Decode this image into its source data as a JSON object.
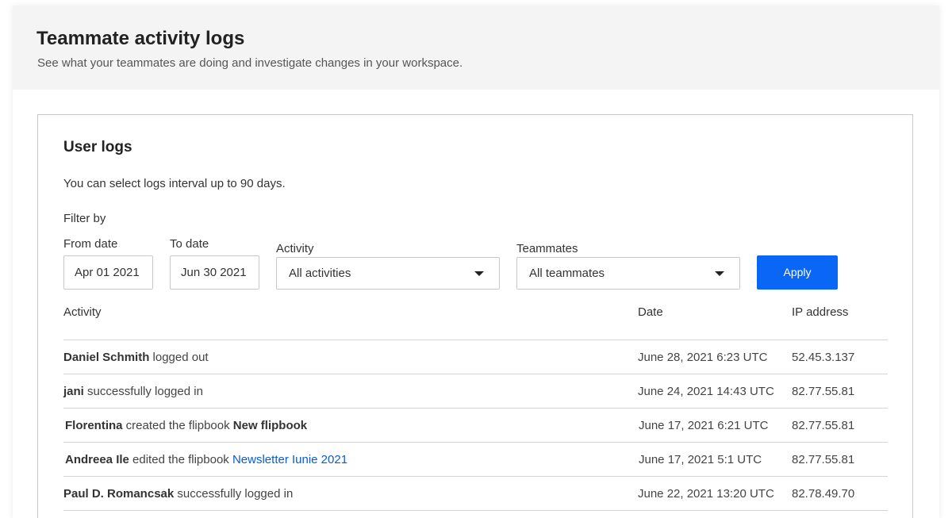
{
  "header": {
    "title": "Teammate activity logs",
    "subtitle": "See what your teammates are doing and investigate changes in your workspace."
  },
  "card": {
    "title": "User logs",
    "note": "You can select logs interval up to 90 days.",
    "filter_label": "Filter by"
  },
  "filters": {
    "from_label": "From date",
    "from_value": "Apr 01 2021",
    "to_label": "To date",
    "to_value": "Jun 30 2021",
    "activity_label": "Activity",
    "activity_value": "All activities",
    "teammates_label": "Teammates",
    "teammates_value": "All teammates",
    "apply_label": "Apply"
  },
  "table": {
    "columns": {
      "activity": "Activity",
      "date": "Date",
      "ip": "IP address"
    },
    "rows": [
      {
        "user": "Daniel Schmith",
        "action": " logged out",
        "target": "",
        "target_link": false,
        "date": "June 28, 2021 6:23 UTC",
        "ip": "52.45.3.137"
      },
      {
        "user": "jani",
        "action": " successfully logged in",
        "target": "",
        "target_link": false,
        "date": "June 24, 2021 14:43 UTC",
        "ip": "82.77.55.81"
      },
      {
        "user": "Florentina",
        "action": " created the flipbook ",
        "target": "New flipbook",
        "target_link": false,
        "date": "June 17, 2021 6:21 UTC",
        "ip": "82.77.55.81"
      },
      {
        "user": "Andreea Ile",
        "action": " edited the flipbook ",
        "target": "Newsletter Iunie 2021",
        "target_link": true,
        "date": "June 17, 2021 5:1 UTC",
        "ip": "82.77.55.81"
      },
      {
        "user": "Paul D. Romancsak",
        "action": " successfully logged in",
        "target": "",
        "target_link": false,
        "date": "June 22, 2021 13:20 UTC",
        "ip": "82.78.49.70"
      }
    ]
  },
  "colors": {
    "accent": "#0a66f5",
    "link": "#0a5bd6",
    "header_bg": "#f4f4f4"
  }
}
